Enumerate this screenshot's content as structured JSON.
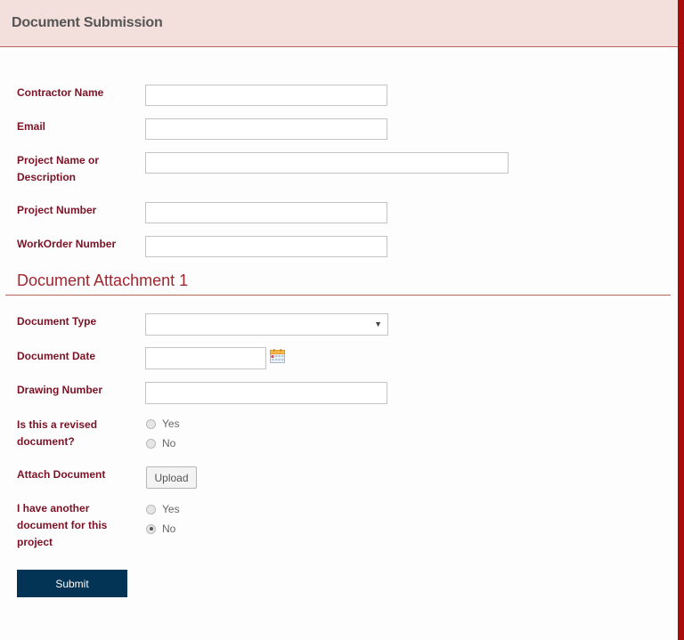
{
  "header": {
    "title": "Document Submission"
  },
  "project_fields": [
    {
      "label": "Contractor Name",
      "value": "",
      "placeholder": ""
    },
    {
      "label": "Email",
      "value": "",
      "placeholder": ""
    },
    {
      "label_line1": "Project Name or",
      "label_line2": "Description",
      "value": "",
      "placeholder": ""
    },
    {
      "label": "Project Number",
      "value": "",
      "placeholder": ""
    },
    {
      "label": "WorkOrder Number",
      "value": "",
      "placeholder": ""
    }
  ],
  "attachment": {
    "section_title": "Document Attachment 1",
    "document_type": {
      "label": "Document Type",
      "selected": "",
      "dropdown_icon": "caret-down-icon"
    },
    "document_date": {
      "label": "Document Date",
      "value": "",
      "icon": "calendar-icon"
    },
    "drawing_number": {
      "label": "Drawing Number",
      "value": ""
    },
    "revised": {
      "label_line1": "Is this a revised",
      "label_line2": "document?",
      "options": [
        {
          "label": "Yes",
          "checked": false
        },
        {
          "label": "No",
          "checked": false
        }
      ]
    },
    "attach": {
      "label": "Attach Document",
      "button_label": "Upload"
    },
    "another": {
      "label_line1": "I have another",
      "label_line2": "document for this",
      "label_line3": "project",
      "options": [
        {
          "label": "Yes",
          "checked": false
        },
        {
          "label": "No",
          "checked": true
        }
      ]
    }
  },
  "submit_label": "Submit",
  "colors": {
    "header_bg": "#f3dfdc",
    "label": "#7c1226",
    "section_title": "#a3262e",
    "submit_bg": "#033355",
    "accent_bar": "#a80c0c"
  }
}
